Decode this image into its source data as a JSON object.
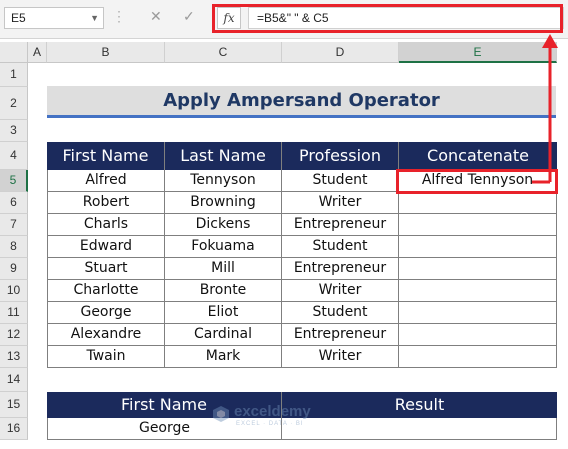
{
  "formula_bar": {
    "name_box": "E5",
    "cancel_icon": "✕",
    "enter_icon": "✓",
    "fx_label": "fx",
    "formula": "=B5&\" \" & C5"
  },
  "columns": [
    "A",
    "B",
    "C",
    "D",
    "E"
  ],
  "rows": [
    "1",
    "2",
    "3",
    "4",
    "5",
    "6",
    "7",
    "8",
    "9",
    "10",
    "11",
    "12",
    "13",
    "14",
    "15",
    "16"
  ],
  "title": "Apply Ampersand Operator",
  "table": {
    "headers": [
      "First Name",
      "Last Name",
      "Profession",
      "Concatenate"
    ],
    "rows": [
      [
        "Alfred",
        "Tennyson",
        "Student",
        "Alfred Tennyson"
      ],
      [
        "Robert",
        "Browning",
        "Writer",
        ""
      ],
      [
        "Charls",
        "Dickens",
        "Entrepreneur",
        ""
      ],
      [
        "Edward",
        "Fokuama",
        "Student",
        ""
      ],
      [
        "Stuart",
        "Mill",
        "Entrepreneur",
        ""
      ],
      [
        "Charlotte",
        "Bronte",
        "Writer",
        ""
      ],
      [
        "George",
        "Eliot",
        "Student",
        ""
      ],
      [
        "Alexandre",
        "Cardinal",
        "Entrepreneur",
        ""
      ],
      [
        "Twain",
        "Mark",
        "Writer",
        ""
      ]
    ]
  },
  "lookup": {
    "headers": [
      "First Name",
      "Result"
    ],
    "values": [
      "George",
      ""
    ]
  },
  "watermark": {
    "name": "exceldemy",
    "tagline": "EXCEL · DATA · BI"
  },
  "colors": {
    "header_fill": "#1b2a5c",
    "title_underline": "#4472c4",
    "highlight": "#e8222a",
    "excel_green": "#1e7145"
  }
}
